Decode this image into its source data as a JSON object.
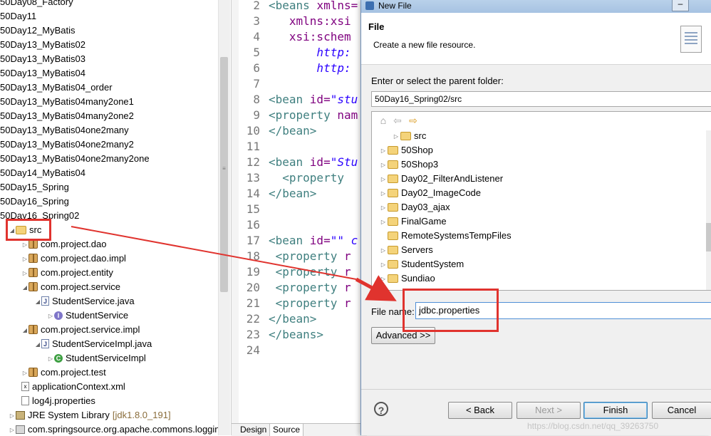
{
  "explorer": {
    "rows": [
      {
        "label": "50Day08_Factory",
        "indent": 0,
        "icon": "project"
      },
      {
        "label": "50Day11",
        "indent": 0,
        "icon": "project"
      },
      {
        "label": "50Day12_MyBatis",
        "indent": 0,
        "icon": "project"
      },
      {
        "label": "50Day13_MyBatis02",
        "indent": 0,
        "icon": "project"
      },
      {
        "label": "50Day13_MyBatis03",
        "indent": 0,
        "icon": "project"
      },
      {
        "label": "50Day13_MyBatis04",
        "indent": 0,
        "icon": "project"
      },
      {
        "label": "50Day13_MyBatis04_order",
        "indent": 0,
        "icon": "project"
      },
      {
        "label": "50Day13_MyBatis04many2one1",
        "indent": 0,
        "icon": "project"
      },
      {
        "label": "50Day13_MyBatis04many2one2",
        "indent": 0,
        "icon": "project"
      },
      {
        "label": "50Day13_MyBatis04one2many",
        "indent": 0,
        "icon": "project"
      },
      {
        "label": "50Day13_MyBatis04one2many2",
        "indent": 0,
        "icon": "project"
      },
      {
        "label": "50Day13_MyBatis04one2many2one",
        "indent": 0,
        "icon": "project"
      },
      {
        "label": "50Day14_MyBatis04",
        "indent": 0,
        "icon": "project"
      },
      {
        "label": "50Day15_Spring",
        "indent": 0,
        "icon": "project"
      },
      {
        "label": "50Day16_Spring",
        "indent": 0,
        "icon": "project"
      },
      {
        "label": "50Day16_Spring02",
        "indent": 0,
        "icon": "project"
      },
      {
        "label": "src",
        "indent": 1,
        "icon": "src-folder",
        "twist": "open"
      },
      {
        "label": "com.project.dao",
        "indent": 2,
        "icon": "package",
        "twist": "closed"
      },
      {
        "label": "com.project.dao.impl",
        "indent": 2,
        "icon": "package",
        "twist": "closed"
      },
      {
        "label": "com.project.entity",
        "indent": 2,
        "icon": "package",
        "twist": "closed"
      },
      {
        "label": "com.project.service",
        "indent": 2,
        "icon": "package",
        "twist": "open"
      },
      {
        "label": "StudentService.java",
        "indent": 3,
        "icon": "java-file",
        "twist": "open"
      },
      {
        "label": "StudentService",
        "indent": 4,
        "icon": "interface",
        "twist": "closed"
      },
      {
        "label": "com.project.service.impl",
        "indent": 2,
        "icon": "package",
        "twist": "open"
      },
      {
        "label": "StudentServiceImpl.java",
        "indent": 3,
        "icon": "java-file",
        "twist": "open"
      },
      {
        "label": "StudentServiceImpl",
        "indent": 4,
        "icon": "class",
        "twist": "closed"
      },
      {
        "label": "com.project.test",
        "indent": 2,
        "icon": "package",
        "twist": "closed"
      },
      {
        "label": "applicationContext.xml",
        "indent": 2,
        "icon": "xml-file"
      },
      {
        "label": "log4j.properties",
        "indent": 2,
        "icon": "properties-file"
      },
      {
        "label": "JRE System Library",
        "suffix": "[jdk1.8.0_191]",
        "indent": 1,
        "icon": "library",
        "twist": "closed"
      },
      {
        "label": "com.springsource.org.apache.commons.loggin",
        "indent": 1,
        "icon": "jar",
        "twist": "closed"
      }
    ]
  },
  "editor": {
    "line_numbers": [
      "2",
      "3",
      "4",
      "5",
      "6",
      "7",
      "8",
      "9",
      "10",
      "11",
      "12",
      "13",
      "14",
      "15",
      "16",
      "17",
      "18",
      "19",
      "20",
      "21",
      "22",
      "23",
      "24"
    ],
    "lines": [
      [
        {
          "t": "tag",
          "s": "<beans "
        },
        {
          "t": "attr",
          "s": "xmlns="
        }
      ],
      [
        {
          "t": "attr",
          "s": "   xmlns:xsi"
        }
      ],
      [
        {
          "t": "attr",
          "s": "   xsi:schem"
        }
      ],
      [
        {
          "t": "val",
          "s": "       http:"
        }
      ],
      [
        {
          "t": "val",
          "s": "       http:"
        }
      ],
      [],
      [
        {
          "t": "tag",
          "s": "<bean "
        },
        {
          "t": "attr",
          "s": "id="
        },
        {
          "t": "val",
          "s": "\"stu"
        }
      ],
      [
        {
          "t": "tag",
          "s": "<property "
        },
        {
          "t": "attr",
          "s": "nam"
        }
      ],
      [
        {
          "t": "tag",
          "s": "</bean>"
        }
      ],
      [],
      [
        {
          "t": "tag",
          "s": "<bean "
        },
        {
          "t": "attr",
          "s": "id="
        },
        {
          "t": "val",
          "s": "\"Stu"
        }
      ],
      [
        {
          "t": "tag",
          "s": "  <property "
        }
      ],
      [
        {
          "t": "tag",
          "s": "</bean>"
        }
      ],
      [],
      [],
      [
        {
          "t": "tag",
          "s": "<bean "
        },
        {
          "t": "attr",
          "s": "id="
        },
        {
          "t": "val",
          "s": "\"\" c"
        }
      ],
      [
        {
          "t": "tag",
          "s": " <property "
        },
        {
          "t": "attr",
          "s": "r"
        }
      ],
      [
        {
          "t": "tag",
          "s": " <property "
        },
        {
          "t": "attr",
          "s": "r"
        }
      ],
      [
        {
          "t": "tag",
          "s": " <property "
        },
        {
          "t": "attr",
          "s": "r"
        }
      ],
      [
        {
          "t": "tag",
          "s": " <property "
        },
        {
          "t": "attr",
          "s": "r"
        }
      ],
      [
        {
          "t": "tag",
          "s": "</bean>"
        }
      ],
      [
        {
          "t": "tag",
          "s": "</beans>"
        }
      ],
      []
    ],
    "tabs": [
      "Design",
      "Source"
    ]
  },
  "dialog": {
    "title": "New File",
    "header_title": "File",
    "header_description": "Create a new file resource.",
    "parent_label": "Enter or select the parent folder:",
    "parent_value": "50Day16_Spring02/src",
    "folder_tree": [
      {
        "label": "src",
        "indent": 1,
        "twist": "closed",
        "icon": "open-folder"
      },
      {
        "label": "50Shop",
        "indent": 0,
        "twist": "closed",
        "icon": "project"
      },
      {
        "label": "50Shop3",
        "indent": 0,
        "twist": "closed",
        "icon": "project"
      },
      {
        "label": "Day02_FilterAndListener",
        "indent": 0,
        "twist": "closed",
        "icon": "project"
      },
      {
        "label": "Day02_ImageCode",
        "indent": 0,
        "twist": "closed",
        "icon": "project"
      },
      {
        "label": "Day03_ajax",
        "indent": 0,
        "twist": "closed",
        "icon": "project"
      },
      {
        "label": "FinalGame",
        "indent": 0,
        "twist": "closed",
        "icon": "project"
      },
      {
        "label": "RemoteSystemsTempFiles",
        "indent": 0,
        "twist": "none",
        "icon": "project"
      },
      {
        "label": "Servers",
        "indent": 0,
        "twist": "closed",
        "icon": "project"
      },
      {
        "label": "StudentSystem",
        "indent": 0,
        "twist": "closed",
        "icon": "project"
      },
      {
        "label": "Sundiao",
        "indent": 0,
        "twist": "closed",
        "icon": "project"
      }
    ],
    "file_name_label": "File name:",
    "file_name_value": "jdbc.properties",
    "advanced_label": "Advanced >>",
    "back_label": "< Back",
    "next_label": "Next >",
    "finish_label": "Finish",
    "cancel_label": "Cancel"
  },
  "watermark": "https://blog.csdn.net/qq_39263750",
  "colors": {
    "annotation_red": "#e0332e",
    "title_bar": "#b9d1ea"
  }
}
